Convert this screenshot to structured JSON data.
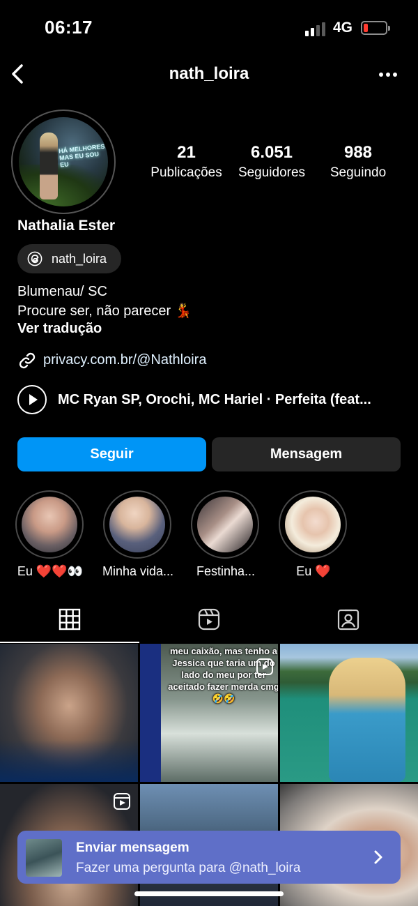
{
  "status_bar": {
    "time": "06:17",
    "network": "4G"
  },
  "header": {
    "username": "nath_loira"
  },
  "profile": {
    "name": "Nathalia Ester",
    "threads_handle": "nath_loira",
    "stats": [
      {
        "value": "21",
        "label": "Publicações"
      },
      {
        "value": "6.051",
        "label": "Seguidores"
      },
      {
        "value": "988",
        "label": "Seguindo"
      }
    ],
    "bio": [
      "Blumenau/ SC",
      "Procure ser, não parecer 💃"
    ],
    "translate_label": "Ver tradução",
    "link": "privacy.com.br/@Nathloira",
    "music": "MC Ryan SP, Orochi, MC Hariel · Perfeita (feat..."
  },
  "buttons": {
    "follow": "Seguir",
    "message": "Mensagem"
  },
  "highlights": [
    {
      "label": "Eu ❤️❤️👀"
    },
    {
      "label": "Minha vida..."
    },
    {
      "label": "Festinha..."
    },
    {
      "label": "Eu ❤️"
    }
  ],
  "tabs": [
    "grid-icon",
    "reels-icon",
    "tagged-icon"
  ],
  "grid": {
    "post2_caption": "meu caixão, mas tenho a Jessica que taria um do lado do meu por ter aceitado fazer merda cmg 🤣🤣"
  },
  "banner": {
    "title": "Enviar mensagem",
    "subtitle": "Fazer uma pergunta para @nath_loira"
  },
  "colors": {
    "accent": "#0095f6",
    "banner": "#5f6fc8",
    "secondary_button": "#262626"
  }
}
